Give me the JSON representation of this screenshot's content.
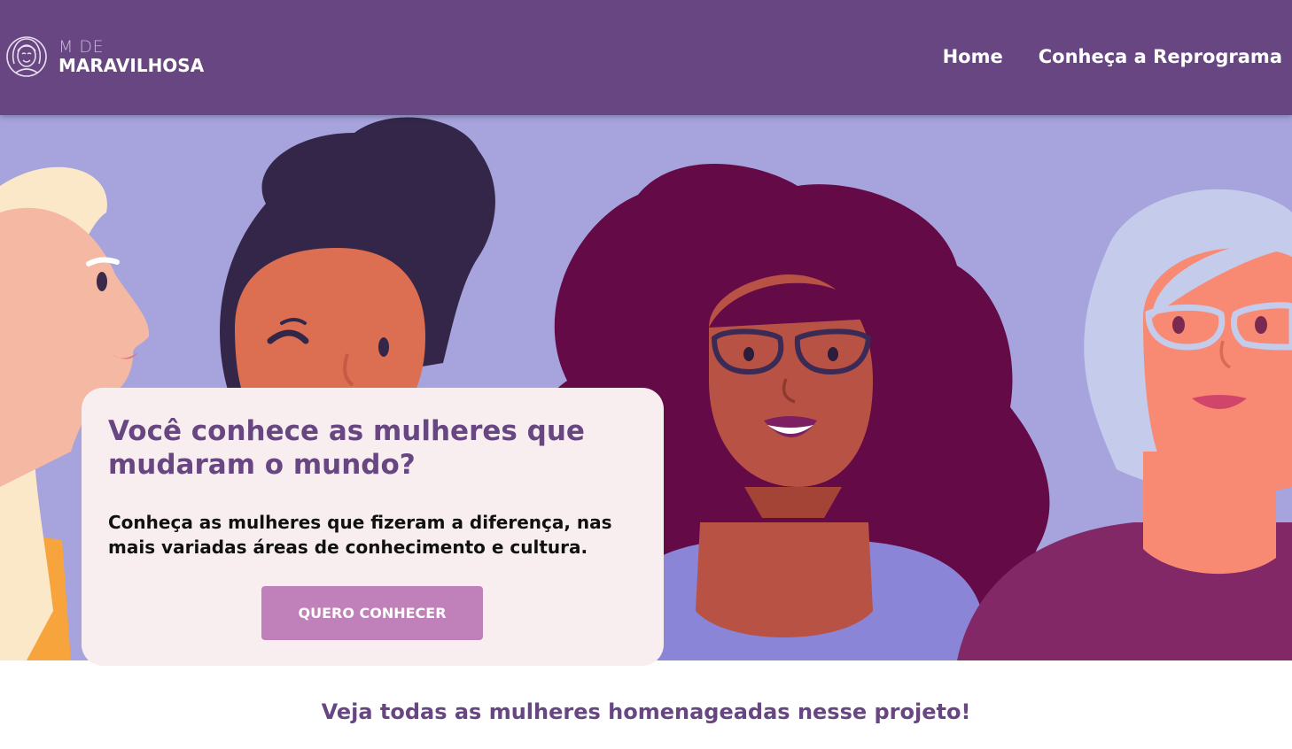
{
  "header": {
    "logo_top": "M DE",
    "logo_bottom": "MARAVILHOSA",
    "logo_icon": "woman-face-icon",
    "nav": [
      {
        "label": "Home"
      },
      {
        "label": "Conheça a Reprograma"
      }
    ]
  },
  "hero": {
    "image": "illustration-four-women",
    "card": {
      "title": "Você conhece as mulheres que mudaram o mundo?",
      "text": "Conheça as mulheres que fizeram a diferença, nas mais variadas áreas de conhecimento e cultura.",
      "button_label": "QUERO CONHECER"
    }
  },
  "footer_text": "Veja todas as mulheres homenageadas nesse projeto!",
  "colors": {
    "header_bg": "#674682",
    "hero_bg": "#a6a3dd",
    "card_bg": "#f8eef0",
    "accent_text": "#674682",
    "button_bg": "#c080b9"
  }
}
